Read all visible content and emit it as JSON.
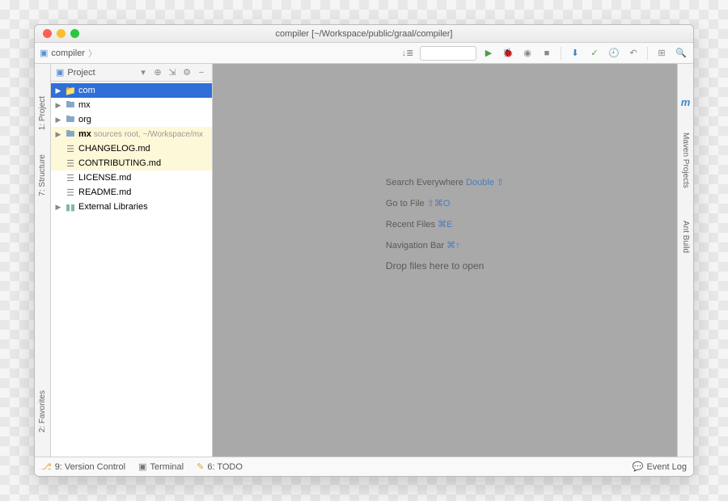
{
  "titlebar": {
    "title": "compiler [~/Workspace/public/graal/compiler]"
  },
  "breadcrumb": {
    "module": "compiler"
  },
  "left_gutter": {
    "project": "1: Project",
    "structure": "7: Structure",
    "favorites": "2: Favorites"
  },
  "right_gutter": {
    "maven": "Maven Projects",
    "ant": "Ant Build"
  },
  "sidebar": {
    "header": "Project",
    "items": [
      {
        "label": "com",
        "kind": "folder-sel"
      },
      {
        "label": "mx",
        "kind": "folder"
      },
      {
        "label": "org",
        "kind": "folder"
      },
      {
        "label": "mx",
        "kind": "folder-hl",
        "suffix": " sources root,  ~/Workspace/mx"
      },
      {
        "label": "CHANGELOG.md",
        "kind": "file-hl"
      },
      {
        "label": "CONTRIBUTING.md",
        "kind": "file-hl"
      },
      {
        "label": "LICENSE.md",
        "kind": "file"
      },
      {
        "label": "README.md",
        "kind": "file"
      },
      {
        "label": "External Libraries",
        "kind": "lib"
      }
    ]
  },
  "hints": {
    "l1a": "Search Everywhere ",
    "l1b": "Double ⇧",
    "l2a": "Go to File ",
    "l2b": "⇧⌘O",
    "l3a": "Recent Files ",
    "l3b": "⌘E",
    "l4a": "Navigation Bar ",
    "l4b": "⌘↑",
    "l5": "Drop files here to open"
  },
  "status": {
    "vcs": "9: Version Control",
    "terminal": "Terminal",
    "todo": "6: TODO",
    "eventlog": "Event Log"
  }
}
